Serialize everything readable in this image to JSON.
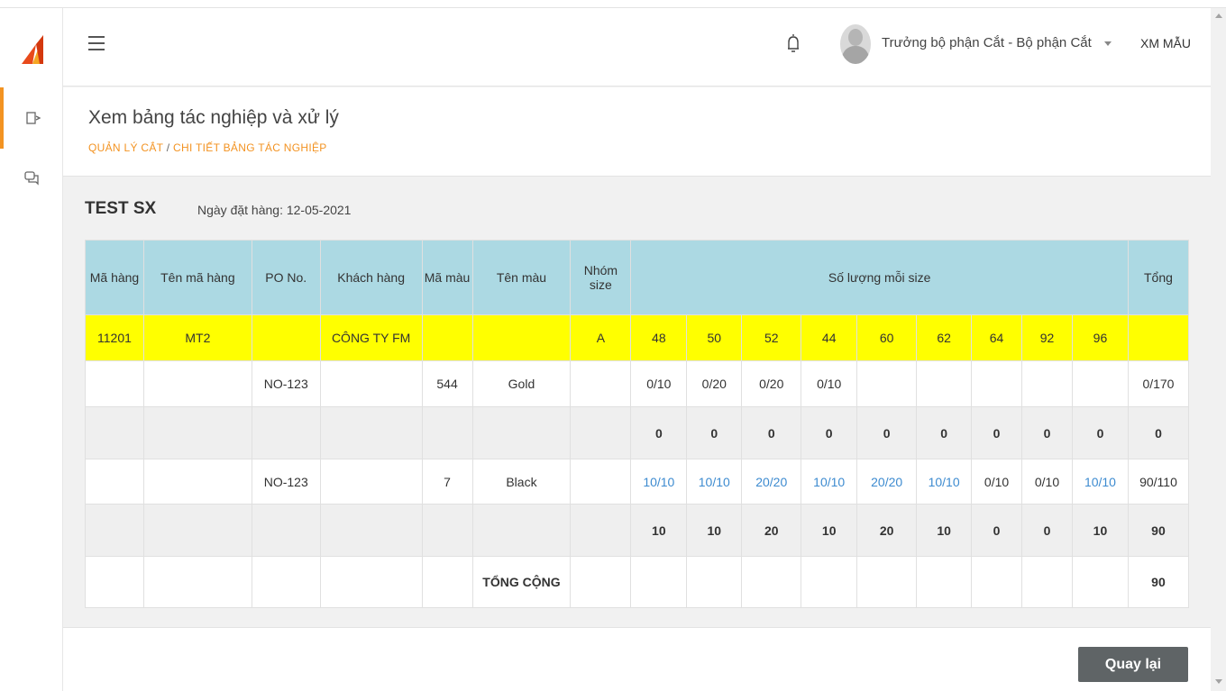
{
  "header": {
    "user_name": "Trưởng bộ phận Cắt - Bộ phận Cắt",
    "company": "XM MẪU"
  },
  "page": {
    "title": "Xem bảng tác nghiệp và xử lý",
    "breadcrumb": [
      "QUẢN LÝ CẮT",
      "CHI TIẾT BẢNG TÁC NGHIỆP"
    ],
    "breadcrumb_sep": "/"
  },
  "order": {
    "title": "TEST SX",
    "date_label": "Ngày đặt hàng: 12-05-2021"
  },
  "table": {
    "headers": {
      "ma_hang": "Mã hàng",
      "ten_ma_hang": "Tên mã hàng",
      "po_no": "PO No.",
      "khach_hang": "Khách hàng",
      "ma_mau": "Mã màu",
      "ten_mau": "Tên màu",
      "nhom_size": "Nhóm size",
      "so_luong": "Số lượng mỗi size",
      "tong": "Tổng"
    },
    "product_row": {
      "ma_hang": "11201",
      "ten_ma_hang": "MT2",
      "po_no": "",
      "khach_hang": "CÔNG TY FM",
      "ma_mau": "",
      "ten_mau": "",
      "nhom_size": "A",
      "sizes": [
        "48",
        "50",
        "52",
        "44",
        "60",
        "62",
        "64",
        "92",
        "96"
      ],
      "tong": ""
    },
    "color_rows": [
      {
        "po_no": "NO-123",
        "ma_mau": "544",
        "ten_mau": "Gold",
        "sizes": [
          "0/10",
          "0/20",
          "0/20",
          "0/10",
          "",
          "",
          "",
          "",
          ""
        ],
        "tong": "0/170",
        "subtotal_sizes": [
          "0",
          "0",
          "0",
          "0",
          "0",
          "0",
          "0",
          "0",
          "0"
        ],
        "subtotal_tong": "0"
      },
      {
        "po_no": "NO-123",
        "ma_mau": "7",
        "ten_mau": "Black",
        "sizes": [
          "10/10",
          "10/10",
          "20/20",
          "10/10",
          "20/20",
          "10/10",
          "0/10",
          "0/10",
          "10/10"
        ],
        "tong": "90/110",
        "subtotal_sizes": [
          "10",
          "10",
          "20",
          "10",
          "20",
          "10",
          "0",
          "0",
          "10"
        ],
        "subtotal_tong": "90"
      }
    ],
    "total_label": "TỔNG CỘNG",
    "total_value": "90"
  },
  "footer": {
    "back_label": "Quay lại"
  }
}
